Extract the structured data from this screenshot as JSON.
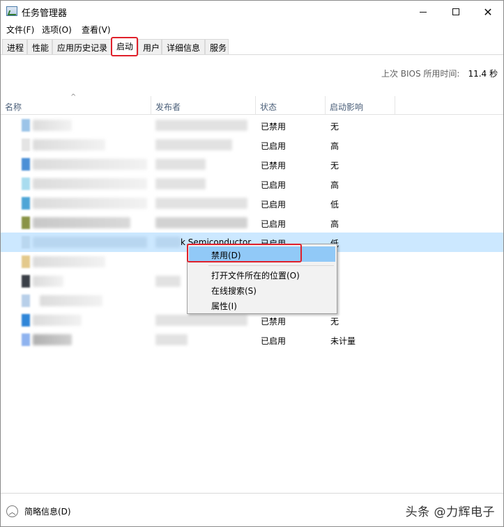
{
  "window": {
    "title": "任务管理器",
    "buttons": {
      "minimize": "—",
      "maximize": "☐",
      "close": "✕"
    }
  },
  "menu": {
    "file": "文件(F)",
    "options": "选项(O)",
    "view": "查看(V)"
  },
  "tabs": [
    {
      "label": "进程"
    },
    {
      "label": "性能"
    },
    {
      "label": "应用历史记录"
    },
    {
      "label": "启动"
    },
    {
      "label": "用户"
    },
    {
      "label": "详细信息"
    },
    {
      "label": "服务"
    }
  ],
  "bios": {
    "label": "上次 BIOS 所用时间:",
    "value": "11.4 秒"
  },
  "columns": {
    "name": "名称",
    "publisher": "发布者",
    "status": "状态",
    "impact": "启动影响",
    "sort_indicator": "^"
  },
  "rows": [
    {
      "status": "已禁用",
      "impact": "无",
      "publisher_visible": ""
    },
    {
      "status": "已启用",
      "impact": "高",
      "publisher_visible": ""
    },
    {
      "status": "已禁用",
      "impact": "无",
      "publisher_visible": ""
    },
    {
      "status": "已启用",
      "impact": "高",
      "publisher_visible": ""
    },
    {
      "status": "已启用",
      "impact": "低",
      "publisher_visible": ""
    },
    {
      "status": "已启用",
      "impact": "高",
      "publisher_visible": ""
    },
    {
      "status": "已启用",
      "impact": "低",
      "publisher_visible": "k Semiconductor"
    },
    {
      "status": "",
      "impact": "",
      "publisher_visible": ""
    },
    {
      "status": "",
      "impact": "",
      "publisher_visible": ""
    },
    {
      "status": "",
      "impact": "",
      "publisher_visible": ""
    },
    {
      "status": "已禁用",
      "impact": "无",
      "publisher_visible": ""
    },
    {
      "status": "已启用",
      "impact": "未计量",
      "publisher_visible": ""
    }
  ],
  "context_menu": {
    "disable": "禁用(D)",
    "open_location": "打开文件所在的位置(O)",
    "search_online": "在线搜索(S)",
    "properties": "属性(I)"
  },
  "footer": {
    "toggle_label": "简略信息(D)",
    "toggle_icon": "chevron-up-icon",
    "watermark": "头条 @力辉电子"
  },
  "colors": {
    "selection": "#cce8ff",
    "menu_highlight": "#91c9f7",
    "annotation_red": "#e0202a",
    "header_text": "#4c607a"
  }
}
